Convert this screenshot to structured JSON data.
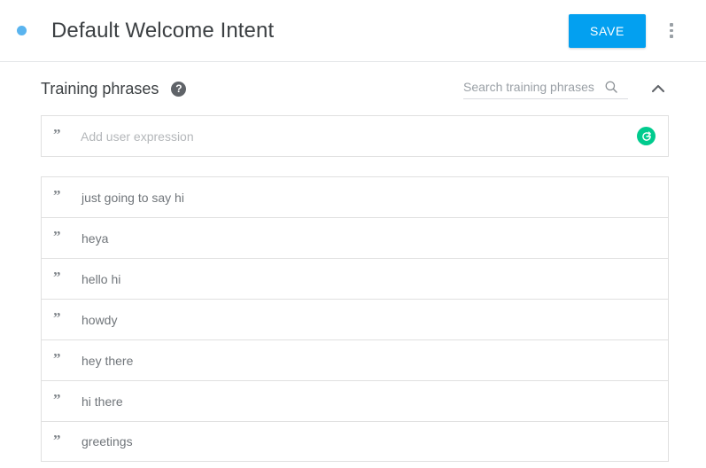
{
  "header": {
    "status_dot_color": "#5ab4ef",
    "title": "Default Welcome Intent",
    "save_label": "SAVE",
    "save_color": "#03a0f0",
    "more_options_label": "More options"
  },
  "section": {
    "title": "Training phrases",
    "help_label": "?",
    "search_placeholder": "Search training phrases",
    "search_value": ""
  },
  "add_expression": {
    "placeholder": "Add user expression",
    "value": "",
    "badge_color": "#00cb8e",
    "badge_label": "G"
  },
  "phrases": [
    {
      "text": "just going to say hi"
    },
    {
      "text": "heya"
    },
    {
      "text": "hello hi"
    },
    {
      "text": "howdy"
    },
    {
      "text": "hey there"
    },
    {
      "text": "hi there"
    },
    {
      "text": "greetings"
    }
  ],
  "icons": {
    "quote": "”"
  }
}
